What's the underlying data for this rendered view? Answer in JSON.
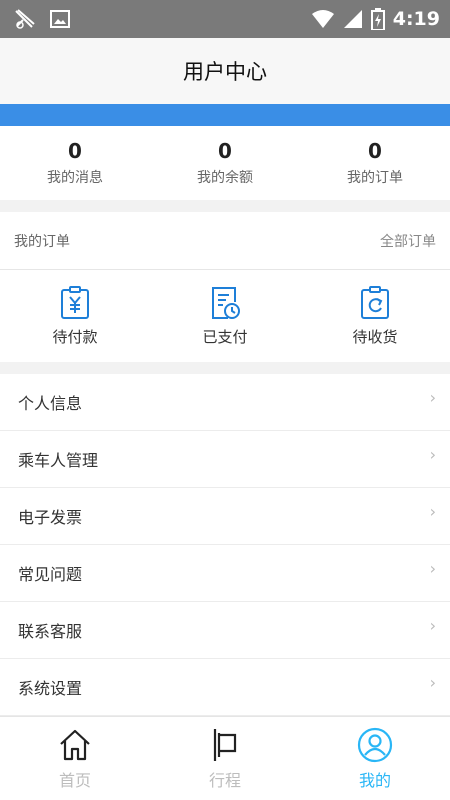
{
  "status_bar": {
    "time": "4:19"
  },
  "header": {
    "title": "用户中心"
  },
  "stats": [
    {
      "value": "0",
      "label": "我的消息"
    },
    {
      "value": "0",
      "label": "我的余额"
    },
    {
      "value": "0",
      "label": "我的订单"
    }
  ],
  "orders": {
    "title": "我的订单",
    "all_label": "全部订单",
    "items": [
      {
        "label": "待付款",
        "icon": "yuan-clipboard-icon"
      },
      {
        "label": "已支付",
        "icon": "document-clock-icon"
      },
      {
        "label": "待收货",
        "icon": "clipboard-refresh-icon"
      }
    ]
  },
  "menu": [
    {
      "label": "个人信息"
    },
    {
      "label": "乘车人管理"
    },
    {
      "label": "电子发票"
    },
    {
      "label": "常见问题"
    },
    {
      "label": "联系客服"
    },
    {
      "label": "系统设置"
    }
  ],
  "tabbar": [
    {
      "label": "首页",
      "icon": "home-icon"
    },
    {
      "label": "行程",
      "icon": "flag-icon"
    },
    {
      "label": "我的",
      "icon": "user-icon",
      "active": true
    }
  ],
  "colors": {
    "accent": "#3a8ee6",
    "tab_active": "#29b6f6",
    "icon_blue": "#1e7fd8"
  }
}
